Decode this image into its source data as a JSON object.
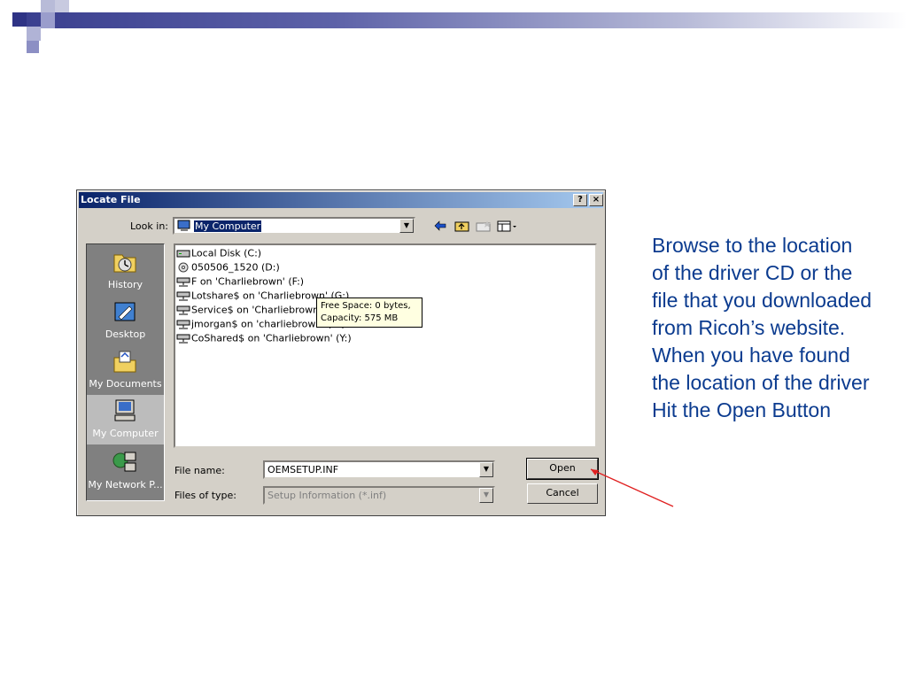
{
  "slide": {
    "body_text": "Browse to the location of the driver CD or the file that you downloaded from Ricoh’s website. When you have found the location of the driver Hit the Open Button",
    "accent_color": "#0b3b8f",
    "arrow_color": "#e02020"
  },
  "dialog": {
    "title": "Locate File",
    "help_button": "?",
    "close_button": "×",
    "look_in_label": "Look in:",
    "look_in_value": "My Computer",
    "places": [
      {
        "label": "History",
        "icon": "history-icon"
      },
      {
        "label": "Desktop",
        "icon": "desktop-icon"
      },
      {
        "label": "My Documents",
        "icon": "my-documents-icon"
      },
      {
        "label": "My Computer",
        "icon": "my-computer-icon"
      },
      {
        "label": "My Network P...",
        "icon": "network-places-icon"
      }
    ],
    "files": [
      {
        "name": "Local Disk (C:)",
        "icon": "hard-drive-icon"
      },
      {
        "name": "050506_1520 (D:)",
        "icon": "cd-drive-icon"
      },
      {
        "name": "F on 'Charliebrown' (F:)",
        "icon": "network-drive-icon"
      },
      {
        "name": "Lotshare$ on 'Charliebrown' (G:)",
        "icon": "network-drive-icon"
      },
      {
        "name": "Service$ on 'Charliebrown' (S:)",
        "icon": "network-drive-icon"
      },
      {
        "name": "jmorgan$ on 'charliebrown' (X:)",
        "icon": "network-drive-icon"
      },
      {
        "name": "CoShared$ on 'Charliebrown' (Y:)",
        "icon": "network-drive-icon"
      }
    ],
    "tooltip_line1": "Free Space: 0 bytes,",
    "tooltip_line2": "Capacity: 575 MB",
    "file_name_label": "File name:",
    "file_name_value": "OEMSETUP.INF",
    "files_of_type_label": "Files of type:",
    "files_of_type_value": "Setup Information (*.inf)",
    "open_button": "Open",
    "cancel_button": "Cancel"
  }
}
